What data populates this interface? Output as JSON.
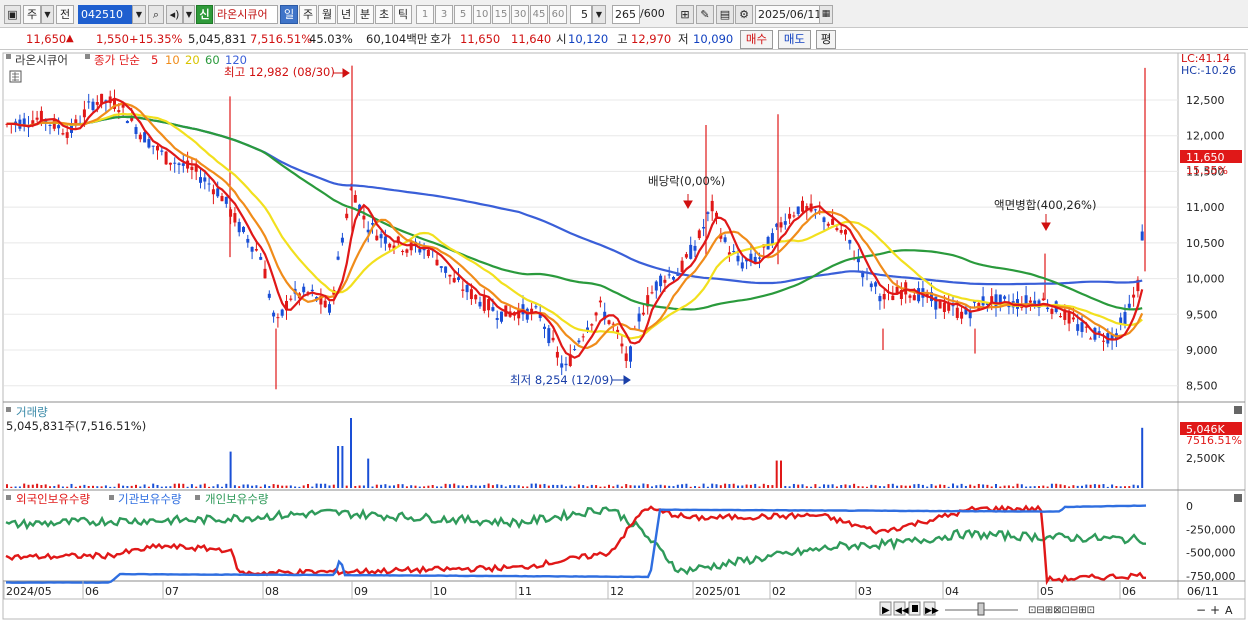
{
  "toolbar": {
    "period_daily_label": "주",
    "prev_label": "전",
    "stock_code": "042510",
    "new_badge": "신",
    "stock_name": "라온시큐어",
    "period_tabs": [
      "일",
      "주",
      "월",
      "년",
      "분",
      "초",
      "틱"
    ],
    "active_period": "일",
    "interval_buttons": [
      "1",
      "3",
      "5",
      "10",
      "15",
      "30",
      "45",
      "60"
    ],
    "interval_value": "5",
    "count_value": "265",
    "count_total": "/600",
    "date_value": "2025/06/11"
  },
  "info": {
    "price": "11,650",
    "change": "1,550",
    "change_pct": "+15.35%",
    "volume": "5,045,831",
    "volume_ratio": "7,516.51%",
    "turnover": "45.03%",
    "amount": "60,104백만",
    "quote_label": "호가",
    "ask": "11,650",
    "bid": "11,640",
    "open_label": "시",
    "open": "10,120",
    "high_label": "고",
    "high": "12,970",
    "low_label": "저",
    "low": "10,090",
    "buy_label": "매수",
    "sell_label": "매도",
    "flat_label": "평"
  },
  "legend": {
    "stock_name": "라온시큐어",
    "ma_label": "종가 단순",
    "ma_periods": [
      "5",
      "10",
      "20",
      "60",
      "120"
    ],
    "volume_title": "거래량",
    "volume_value": "5,045,831주(7,516.51%)",
    "holdings": [
      "외국인보유수량",
      "기관보유수량",
      "개인보유수량"
    ]
  },
  "annotations": {
    "high_marker": "최고 12,982 (08/30)",
    "low_marker": "최저 8,254 (12/09)",
    "dividend_marker": "배당락(0,00%)",
    "split_marker": "액면병합(400,26%)",
    "lc_label": "LC:41.14",
    "hc_label": "HC:-10.26",
    "price_tag": "11,650",
    "pct_tag": "15.35%",
    "vol_tag": "5,046K",
    "vol_pct_tag": "7516.51%"
  },
  "axes": {
    "price_ticks": [
      "12,500",
      "12,000",
      "11,500",
      "11,000",
      "10,500",
      "10,000",
      "9,500",
      "9,000",
      "8,500"
    ],
    "volume_ticks": [
      "2,500K"
    ],
    "holding_ticks": [
      "0",
      "-250,000",
      "-500,000",
      "-750,000"
    ],
    "x_labels": [
      "2024/05",
      "06",
      "07",
      "08",
      "09",
      "10",
      "11",
      "12",
      "2025/01",
      "02",
      "03",
      "04",
      "05",
      "06"
    ],
    "x_right_label": "06/11"
  },
  "colors": {
    "up": "#e01818",
    "down": "#1a4fd6",
    "ma5": "#e01818",
    "ma10": "#f08c1a",
    "ma20": "#f2e01e",
    "ma60": "#2a9a3c",
    "ma120": "#3a5fd8",
    "foreign": "#e01818",
    "institution": "#2f6ee0",
    "individual": "#2f9a5a"
  }
}
